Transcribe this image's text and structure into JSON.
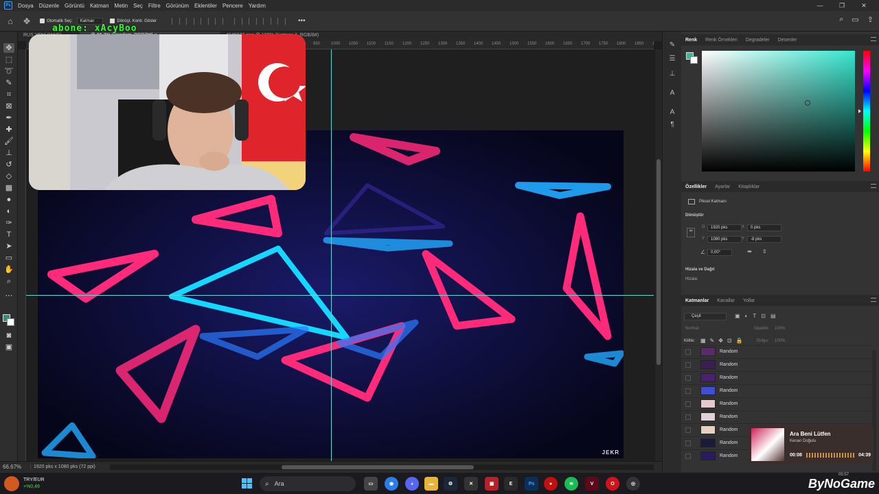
{
  "app": {
    "logo": "Ps"
  },
  "menu": [
    "Dosya",
    "Düzenle",
    "Görüntü",
    "Katman",
    "Metin",
    "Seç",
    "Filtre",
    "Görünüm",
    "Eklentiler",
    "Pencere",
    "Yardım"
  ],
  "window_controls": {
    "minimize": "—",
    "restore": "❐",
    "close": "✕"
  },
  "options": {
    "auto_select": "Otomatik Seç:",
    "auto_select_target": "Katman",
    "show_transform": "Dönüşt. Kontr. Göster",
    "more": "•••"
  },
  "tabs": [
    {
      "label": "RUS YENİ PANEL ...",
      "active": false
    },
    {
      "label": "... @ 66,7% (Random, RGB/8#) ×",
      "active": true
    },
    {
      "label": "4945973.png @ 100% (Katman 1, RGB/8#)",
      "active": false
    }
  ],
  "ruler_ticks": [
    "950",
    "1000",
    "1050",
    "1100",
    "1150",
    "1200",
    "1250",
    "1300",
    "1350",
    "1400",
    "1450",
    "1500",
    "1550",
    "1600",
    "1650",
    "1700",
    "1750",
    "1800",
    "1850",
    "1900",
    "1950",
    "20"
  ],
  "overlay": {
    "text": "abone: xAcyBoo"
  },
  "artwork": {
    "signature": "JEKR"
  },
  "status": {
    "zoom": "66.67%",
    "doc_size": "1920 pks x 1080 pks (72 ppi)"
  },
  "color_panel": {
    "tabs": [
      "Renk",
      "Renk Örnekleri",
      "Degradeler",
      "Desenler"
    ],
    "fg_color": "#3fb39c",
    "bg_color": "#ffffff"
  },
  "properties": {
    "tabs": [
      "Özellikler",
      "Ayarlar",
      "Kitaplıklar"
    ],
    "layer_type": "Piksel Katmanı",
    "transform_title": "Dönüştür",
    "w_label": "G",
    "w": "1920 pks",
    "x_label": "X",
    "x": "0 pks",
    "h_label": "Y",
    "h": "1080 pks",
    "y_label": "Y",
    "y": "-8 pks",
    "angle": "0,00°",
    "align_title": "Hizala ve Dağıt",
    "align_label": "Hizala:"
  },
  "layers": {
    "tabs": [
      "Katmanlar",
      "Kanallar",
      "Yollar"
    ],
    "filter": "Çeşit",
    "blend": "Normal",
    "opacity_label": "Opaklık:",
    "opacity": "100%",
    "lock_label": "Kilitle:",
    "fill_label": "Dolgu:",
    "fill": "100%",
    "items": [
      {
        "name": "Random",
        "thumb": "#5a2a6a"
      },
      {
        "name": "Random",
        "thumb": "#3a2050"
      },
      {
        "name": "Random",
        "thumb": "#4a2070"
      },
      {
        "name": "Random",
        "thumb": "#3f4fd0"
      },
      {
        "name": "Random",
        "thumb": "#e8c8d0"
      },
      {
        "name": "Random",
        "thumb": "#e0d0d8"
      },
      {
        "name": "Random",
        "thumb": "#e8d0c0"
      },
      {
        "name": "Random",
        "thumb": "#1a1a3a"
      },
      {
        "name": "Random",
        "thumb": "#2a1a60"
      }
    ]
  },
  "music": {
    "title": "Ara Beni Lütfen",
    "artist": "Kenan Doğulu",
    "current": "00:08",
    "total": "04:39"
  },
  "taskbar": {
    "ticker_name": "TRY/EUR",
    "ticker_value": "+%0,49",
    "search_label": "Ara",
    "clock": "05:57",
    "brand": "ByNoGame"
  }
}
